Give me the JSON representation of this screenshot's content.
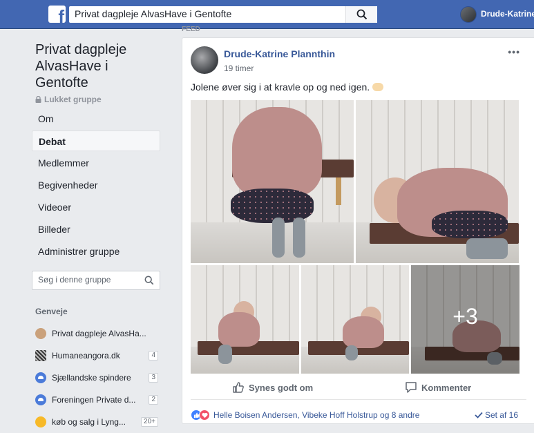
{
  "topbar": {
    "logo": "f",
    "search_text": "Privat dagpleje AlvasHave i Gentofte",
    "user_name": "Drude-Katrine"
  },
  "group": {
    "title": "Privat dagpleje AlvasHave i Gentofte",
    "privacy": "Lukket gruppe",
    "nav": [
      "Om",
      "Debat",
      "Medlemmer",
      "Begivenheder",
      "Videoer",
      "Billeder",
      "Administrer gruppe"
    ],
    "active_nav": "Debat",
    "search_placeholder": "Søg i denne gruppe"
  },
  "shortcuts": {
    "heading": "Genveje",
    "items": [
      {
        "label": "Privat dagpleje AlvasHa...",
        "count": "",
        "icon": "teddy-icon"
      },
      {
        "label": "Humaneangora.dk",
        "count": "4",
        "icon": "photo-icon"
      },
      {
        "label": "Sjællandske spindere",
        "count": "3",
        "icon": "group-icon"
      },
      {
        "label": "Foreningen Private d...",
        "count": "2",
        "icon": "group-icon"
      },
      {
        "label": "køb og salg i Lyng...",
        "count": "20+",
        "icon": "flower-icon"
      }
    ]
  },
  "post": {
    "feed_label": "FEED",
    "author": "Drude-Katrine Plannthin",
    "time": "19 timer",
    "text": "Jolene øver sig i at kravle op og ned igen.",
    "extra_photos": "+3",
    "like_label": "Synes godt om",
    "comment_label": "Kommenter",
    "reactions_text": "Helle Boisen Andersen, Vibeke Hoff Holstrup og 8 andre",
    "seen_text": "Set af 16"
  },
  "colors": {
    "brand": "#4267b2",
    "link": "#385898",
    "background": "#e9ebee"
  }
}
